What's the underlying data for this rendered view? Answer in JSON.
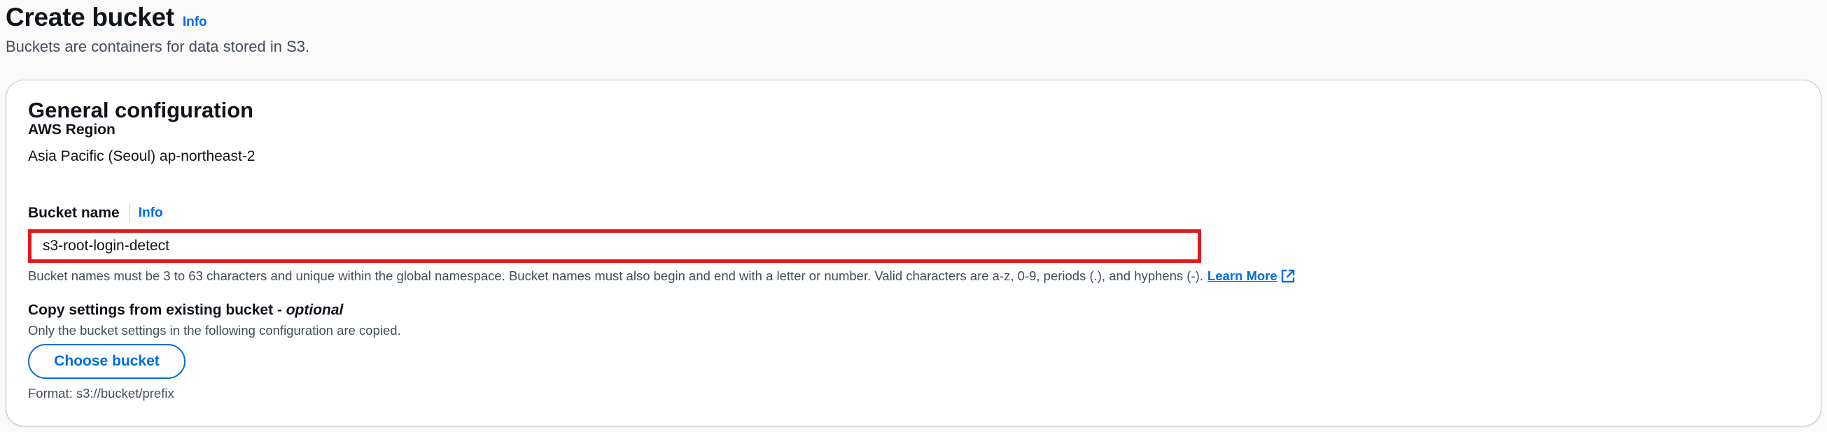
{
  "header": {
    "title": "Create bucket",
    "info_label": "Info",
    "description": "Buckets are containers for data stored in S3."
  },
  "general_config": {
    "title": "General configuration",
    "region": {
      "label": "AWS Region",
      "value": "Asia Pacific (Seoul) ap-northeast-2"
    },
    "bucket_name": {
      "label": "Bucket name",
      "info_label": "Info",
      "value": "s3-root-login-detect",
      "constraint": "Bucket names must be 3 to 63 characters and unique within the global namespace. Bucket names must also begin and end with a letter or number. Valid characters are a-z, 0-9, periods (.), and hyphens (-).",
      "learn_more": "Learn More",
      "learn_more_icon": "external-link-icon"
    },
    "copy_settings": {
      "label": "Copy settings from existing bucket -",
      "optional": "optional",
      "description": "Only the bucket settings in the following configuration are copied.",
      "button_label": "Choose bucket",
      "format_hint": "Format: s3://bucket/prefix"
    }
  },
  "colors": {
    "link": "#006ce0",
    "highlight_border": "#e0191f",
    "text": "#0f141a",
    "secondary_text": "#414d5c"
  }
}
